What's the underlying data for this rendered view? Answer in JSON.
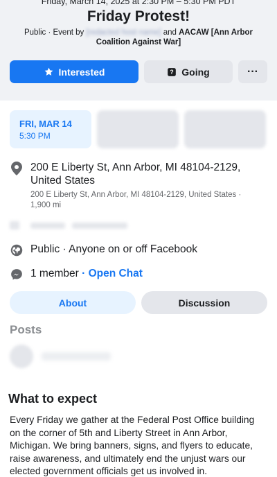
{
  "event": {
    "datetime_line": "Friday, March 14, 2025 at 2:30 PM – 5:30 PM PDT",
    "title": "Friday Protest!",
    "hosts_prefix": "Public · Event by",
    "hosts_redacted": "[redacted host name]",
    "hosts_suffix_and": "and",
    "hosts_org": "AACAW [Ann Arbor Coalition Against War]"
  },
  "actions": {
    "interested_label": "Interested",
    "going_label": "Going",
    "more_label": "···"
  },
  "dates": [
    {
      "day": "FRI, MAR 14",
      "time": "5:30 PM"
    }
  ],
  "location": {
    "address": "200 E Liberty St, Ann Arbor, MI 48104-2129, United States",
    "detail": "200 E Liberty St, Ann Arbor, MI 48104-2129, United States · 1,900 mi"
  },
  "privacy": "Public · Anyone on or off Facebook",
  "chat": {
    "members": "1 member",
    "separator": " · ",
    "open_chat": "Open Chat"
  },
  "tabs": {
    "about": "About",
    "discussion": "Discussion"
  },
  "posts": {
    "heading": "Posts"
  },
  "about": {
    "heading": "What to expect",
    "body": "Every Friday we gather at the Federal Post Office building on the corner of 5th and Liberty Street in Ann Arbor, Michigan. We bring banners, signs, and flyers to educate, raise awareness, and ultimately end the unjust wars our elected government officials get us involved in."
  },
  "colors": {
    "accent": "#1877f2",
    "background_header": "#f0f2f5",
    "button_secondary": "#e4e6eb",
    "chip_active": "#e7f3ff"
  },
  "icons": {
    "interested": "star-icon",
    "going": "question-icon",
    "location": "map-pin-icon",
    "privacy": "globe-icon",
    "chat": "messenger-icon"
  }
}
